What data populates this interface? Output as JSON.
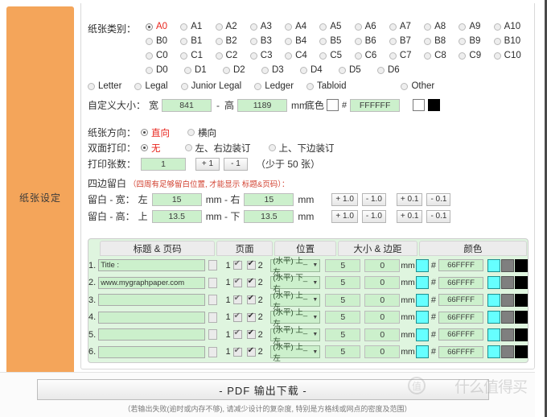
{
  "sidebar": {
    "label": "纸张设定"
  },
  "paper_type": {
    "label": "纸张类别：",
    "selected": "A0",
    "rows": [
      [
        "A0",
        "A1",
        "A2",
        "A3",
        "A4",
        "A5",
        "A6",
        "A7",
        "A8",
        "A9",
        "A10"
      ],
      [
        "B0",
        "B1",
        "B2",
        "B3",
        "B4",
        "B5",
        "B6",
        "B7",
        "B8",
        "B9",
        "B10"
      ],
      [
        "C0",
        "C1",
        "C2",
        "C3",
        "C4",
        "C5",
        "C6",
        "C7",
        "C8",
        "C9",
        "C10"
      ],
      [
        "D0",
        "D1",
        "D2",
        "D3",
        "D4",
        "D5",
        "D6"
      ]
    ],
    "named": [
      "Letter",
      "Legal",
      "Junior Legal",
      "Ledger",
      "Tabloid",
      "Other"
    ]
  },
  "custom_size": {
    "label": "自定义大小：",
    "width_label": "宽",
    "width_value": "841",
    "dash": "-",
    "height_label": "高",
    "height_value": "1189",
    "unit": "mm",
    "bg_label": "底色",
    "hash": "#",
    "bg_hex": "FFFFFF",
    "swatch_white": "#FFFFFF",
    "swatch_black": "#000000"
  },
  "orientation": {
    "label": "纸张方向：",
    "options": [
      "直向",
      "横向"
    ],
    "selected": "直向"
  },
  "duplex": {
    "label": "双面打印：",
    "options": [
      "无",
      "左、右边装订",
      "上、下边装订"
    ],
    "selected": "无"
  },
  "copies": {
    "label": "打印张数：",
    "value": "1",
    "plus": "+ 1",
    "minus": "- 1",
    "note": "（少于 50 张）"
  },
  "margins": {
    "title": "四边留白",
    "note": "（四周有足够留白位置, 才能显示 标题&页码）：",
    "width_row": {
      "label": "留白 - 宽：",
      "left_label": "左",
      "left_value": "15",
      "unit1": "mm - 右",
      "right_value": "15",
      "unit2": "mm",
      "buttons": [
        "+ 1.0",
        "- 1.0",
        "+ 0.1",
        "- 0.1"
      ]
    },
    "height_row": {
      "label": "留白 - 高：",
      "top_label": "上",
      "top_value": "13.5",
      "unit1": "mm - 下",
      "bottom_value": "13.5",
      "unit2": "mm",
      "buttons": [
        "+ 1.0",
        "- 1.0",
        "+ 0.1",
        "- 0.1"
      ]
    }
  },
  "table": {
    "headers": {
      "title": "标题 & 页码",
      "page": "页面",
      "position": "位置",
      "size": "大小 & 边距",
      "color": "颜色"
    },
    "page_labels": {
      "one": "1",
      "two": "2"
    },
    "unit": "mm",
    "hash": "#",
    "rows": [
      {
        "num": "1.",
        "title": "Title :",
        "p1": true,
        "p2": true,
        "position": "(水平) 上_左",
        "size": "5",
        "margin": "0",
        "hex": "66FFFF",
        "sw1": "#66FFFF",
        "sw2": "#7F7F7F",
        "sw3": "#000000"
      },
      {
        "num": "2.",
        "title": "www.mygraphpaper.com",
        "p1": true,
        "p2": true,
        "position": "(水平) 下_右",
        "size": "5",
        "margin": "0",
        "hex": "66FFFF",
        "sw1": "#66FFFF",
        "sw2": "#7F7F7F",
        "sw3": "#000000"
      },
      {
        "num": "3.",
        "title": "",
        "p1": true,
        "p2": true,
        "position": "(水平) 上_左",
        "size": "5",
        "margin": "0",
        "hex": "66FFFF",
        "sw1": "#66FFFF",
        "sw2": "#7F7F7F",
        "sw3": "#000000"
      },
      {
        "num": "4.",
        "title": "",
        "p1": true,
        "p2": true,
        "position": "(水平) 上_左",
        "size": "5",
        "margin": "0",
        "hex": "66FFFF",
        "sw1": "#66FFFF",
        "sw2": "#7F7F7F",
        "sw3": "#000000"
      },
      {
        "num": "5.",
        "title": "",
        "p1": true,
        "p2": true,
        "position": "(水平) 上_左",
        "size": "5",
        "margin": "0",
        "hex": "66FFFF",
        "sw1": "#66FFFF",
        "sw2": "#7F7F7F",
        "sw3": "#000000"
      },
      {
        "num": "6.",
        "title": "",
        "p1": true,
        "p2": true,
        "position": "(水平) 上_左",
        "size": "5",
        "margin": "0",
        "hex": "66FFFF",
        "sw1": "#66FFFF",
        "sw2": "#7F7F7F",
        "sw3": "#000000"
      }
    ]
  },
  "footer": {
    "button": "- PDF 输出下载 -",
    "note": "（若输出失败(逾时或内存不够), 请减少设计的复杂度, 特别是方格线或网点的密度及范围）",
    "watermark": "什么值得买",
    "watermark_mark": "值"
  },
  "colors": {
    "sidebar": "#F4A55A",
    "accent_red": "#E8241C",
    "input_green": "#CCF0CC",
    "panel_green": "#DFF5DF",
    "cyan": "#66FFFF"
  }
}
